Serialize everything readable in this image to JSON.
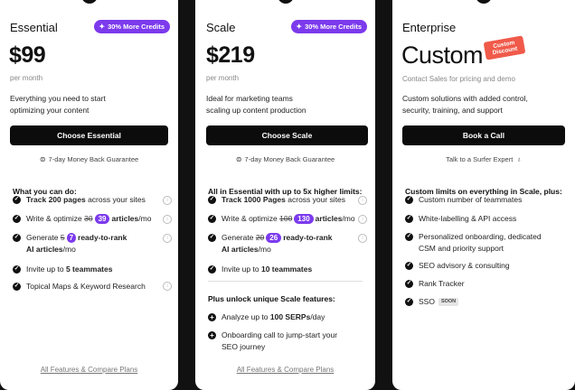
{
  "colors": {
    "accent": "#7c3aed",
    "cta": "#0c0c0c",
    "discount": "#f05a4a",
    "background": "#111111"
  },
  "essential": {
    "name": "Essential",
    "badge": "30% More Credits",
    "price": "$99",
    "per": "per month",
    "desc1": "Everything you need to start",
    "desc2": "optimizing your content",
    "cta": "Choose Essential",
    "guarantee": "7-day Money Back Guarantee",
    "section_title": "What you can do:",
    "f1_bold": "Track 200 pages",
    "f1_rest": "across your sites",
    "f2_pre": "Write & optimize",
    "f2_old": "30",
    "f2_new": "39",
    "f2_bold": "articles",
    "f2_post": "/mo",
    "f3_pre": "Generate",
    "f3_old": "5",
    "f3_new": "7",
    "f3_bold": "ready-to-rank",
    "f3_line2_bold": "AI articles",
    "f3_line2_post": "/mo",
    "f4_pre": "Invite up to",
    "f4_bold": "5 teammates",
    "f5": "Topical Maps & Keyword Research",
    "footer": "All Features & Compare Plans"
  },
  "scale": {
    "name": "Scale",
    "badge": "30% More Credits",
    "price": "$219",
    "per": "per month",
    "desc1": "Ideal for marketing teams",
    "desc2": "scaling up content production",
    "cta": "Choose Scale",
    "guarantee": "7-day Money Back Guarantee",
    "section_title": "All in Essential with up to 5x higher limits:",
    "f1_bold": "Track 1000 Pages",
    "f1_rest": "across your sites",
    "f2_pre": "Write & optimize",
    "f2_old": "100",
    "f2_new": "130",
    "f2_bold": "articles",
    "f2_post": "/mo",
    "f3_pre": "Generate",
    "f3_old": "20",
    "f3_new": "26",
    "f3_bold": "ready-to-rank",
    "f3_line2_bold": "AI articles",
    "f3_line2_post": "/mo",
    "f4_pre": "Invite up to",
    "f4_bold": "10 teammates",
    "unlock_title": "Plus unlock unique Scale features:",
    "u1_pre": "Analyze up to",
    "u1_bold": "100 SERPs",
    "u1_post": "/day",
    "u2_line1": "Onboarding call to jump-start your",
    "u2_line2": "SEO journey",
    "footer": "All Features & Compare Plans"
  },
  "enterprise": {
    "name": "Enterprise",
    "price": "Custom",
    "discount_line1": "Custom",
    "discount_line2": "Discount",
    "per": "Contact Sales for pricing and demo",
    "desc1": "Custom solutions with added control,",
    "desc2": "security, training, and support",
    "cta": "Book a Call",
    "expert": "Talk to a Surfer Expert",
    "section_title": "Custom limits on everything in Scale, plus:",
    "f1": "Custom number of teammates",
    "f2": "White-labelling & API access",
    "f3_line1": "Personalized onboarding, dedicated",
    "f3_line2": "CSM and priority support",
    "f4": "SEO advisory & consulting",
    "f5": "Rank Tracker",
    "f6": "SSO",
    "soon": "SOON"
  }
}
